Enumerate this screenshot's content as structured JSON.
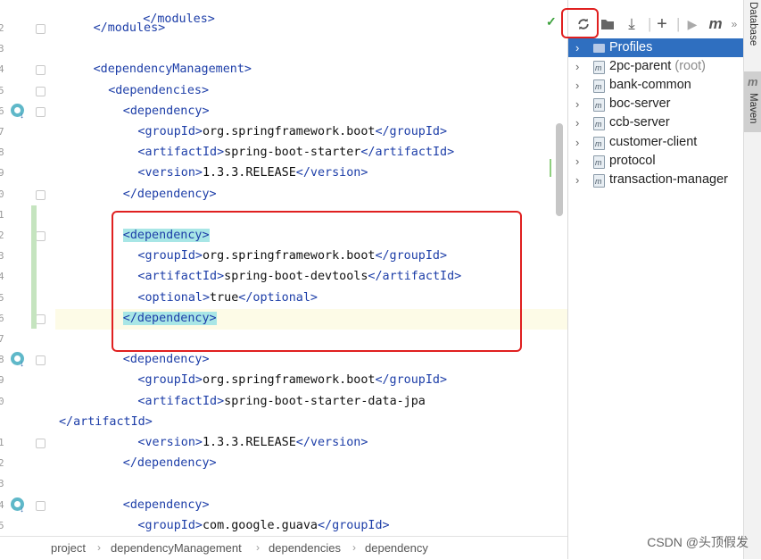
{
  "editor": {
    "top_fragment": "</modules>",
    "lines": [
      {
        "ln": "2",
        "indent": 2,
        "parts": [
          [
            "tag",
            "</modules>"
          ]
        ]
      },
      {
        "ln": "3",
        "indent": 0,
        "parts": []
      },
      {
        "ln": "4",
        "indent": 2,
        "parts": [
          [
            "tag",
            "<dependencyManagement>"
          ]
        ]
      },
      {
        "ln": "5",
        "indent": 4,
        "parts": [
          [
            "tag",
            "<dependencies>"
          ]
        ]
      },
      {
        "ln": "6",
        "indent": 6,
        "parts": [
          [
            "tag",
            "<dependency>"
          ]
        ]
      },
      {
        "ln": "7",
        "indent": 8,
        "parts": [
          [
            "tag",
            "<groupId>"
          ],
          [
            "txt",
            "org.springframework.boot"
          ],
          [
            "tag",
            "</groupId>"
          ]
        ]
      },
      {
        "ln": "8",
        "indent": 8,
        "parts": [
          [
            "tag",
            "<artifactId>"
          ],
          [
            "txt",
            "spring-boot-starter"
          ],
          [
            "tag",
            "</artifactId>"
          ]
        ]
      },
      {
        "ln": "9",
        "indent": 8,
        "parts": [
          [
            "tag",
            "<version>"
          ],
          [
            "txt",
            "1.3.3.RELEASE"
          ],
          [
            "tag",
            "</version>"
          ]
        ]
      },
      {
        "ln": "0",
        "indent": 6,
        "parts": [
          [
            "tag",
            "</dependency>"
          ]
        ]
      },
      {
        "ln": "1",
        "indent": 0,
        "parts": []
      },
      {
        "ln": "2",
        "indent": 6,
        "parts": [
          [
            "hl",
            "<dependency>"
          ]
        ]
      },
      {
        "ln": "3",
        "indent": 8,
        "parts": [
          [
            "tag",
            "<groupId>"
          ],
          [
            "txt",
            "org.springframework.boot"
          ],
          [
            "tag",
            "</groupId>"
          ]
        ]
      },
      {
        "ln": "4",
        "indent": 8,
        "parts": [
          [
            "tag",
            "<artifactId>"
          ],
          [
            "txt",
            "spring-boot-devtools"
          ],
          [
            "tag",
            "</artifactId>"
          ]
        ]
      },
      {
        "ln": "5",
        "indent": 8,
        "parts": [
          [
            "tag",
            "<optional>"
          ],
          [
            "txt",
            "true"
          ],
          [
            "tag",
            "</optional>"
          ]
        ]
      },
      {
        "ln": "6",
        "indent": 6,
        "parts": [
          [
            "hl",
            "</dependency>"
          ]
        ]
      },
      {
        "ln": "7",
        "indent": 0,
        "parts": []
      },
      {
        "ln": "8",
        "indent": 6,
        "parts": [
          [
            "tag",
            "<dependency>"
          ]
        ]
      },
      {
        "ln": "9",
        "indent": 8,
        "parts": [
          [
            "tag",
            "<groupId>"
          ],
          [
            "txt",
            "org.springframework.boot"
          ],
          [
            "tag",
            "</groupId>"
          ]
        ]
      },
      {
        "ln": "0",
        "indent": 8,
        "parts": [
          [
            "tag",
            "<artifactId>"
          ],
          [
            "txt",
            "spring-boot-starter-data-jpa"
          ]
        ]
      },
      {
        "ln": "",
        "indent": 0,
        "parts": [
          [
            "tag",
            "</artifactId>"
          ]
        ]
      },
      {
        "ln": "1",
        "indent": 8,
        "parts": [
          [
            "tag",
            "<version>"
          ],
          [
            "txt",
            "1.3.3.RELEASE"
          ],
          [
            "tag",
            "</version>"
          ]
        ]
      },
      {
        "ln": "2",
        "indent": 6,
        "parts": [
          [
            "tag",
            "</dependency>"
          ]
        ]
      },
      {
        "ln": "3",
        "indent": 0,
        "parts": []
      },
      {
        "ln": "4",
        "indent": 6,
        "parts": [
          [
            "tag",
            "<dependency>"
          ]
        ]
      },
      {
        "ln": "5",
        "indent": 8,
        "parts": [
          [
            "tag",
            "<groupId>"
          ],
          [
            "txt",
            "com.google.guava"
          ],
          [
            "tag",
            "</groupId>"
          ]
        ]
      }
    ]
  },
  "breadcrumb": [
    "project",
    "dependencyManagement",
    "dependencies",
    "dependency"
  ],
  "maven": {
    "toolbar_icons": [
      "refresh-icon",
      "folder-reimport-icon",
      "download-icon",
      "add-icon",
      "run-icon",
      "maven-m-icon",
      "more-icon"
    ],
    "tree": [
      {
        "label": "Profiles",
        "note": "",
        "selected": true,
        "kind": "profiles"
      },
      {
        "label": "2pc-parent",
        "note": "(root)",
        "selected": false,
        "kind": "module"
      },
      {
        "label": "bank-common",
        "note": "",
        "selected": false,
        "kind": "module"
      },
      {
        "label": "boc-server",
        "note": "",
        "selected": false,
        "kind": "module"
      },
      {
        "label": "ccb-server",
        "note": "",
        "selected": false,
        "kind": "module"
      },
      {
        "label": "customer-client",
        "note": "",
        "selected": false,
        "kind": "module"
      },
      {
        "label": "protocol",
        "note": "",
        "selected": false,
        "kind": "module"
      },
      {
        "label": "transaction-manager",
        "note": "",
        "selected": false,
        "kind": "module"
      }
    ]
  },
  "toolstrip": {
    "database": "Database",
    "maven": "Maven"
  },
  "watermark": "CSDN @头顶假发",
  "colors": {
    "tag": "#1d3ea8",
    "selection": "#2f6fc0",
    "annotation": "#e02020",
    "match_highlight": "#a8e6e6"
  }
}
